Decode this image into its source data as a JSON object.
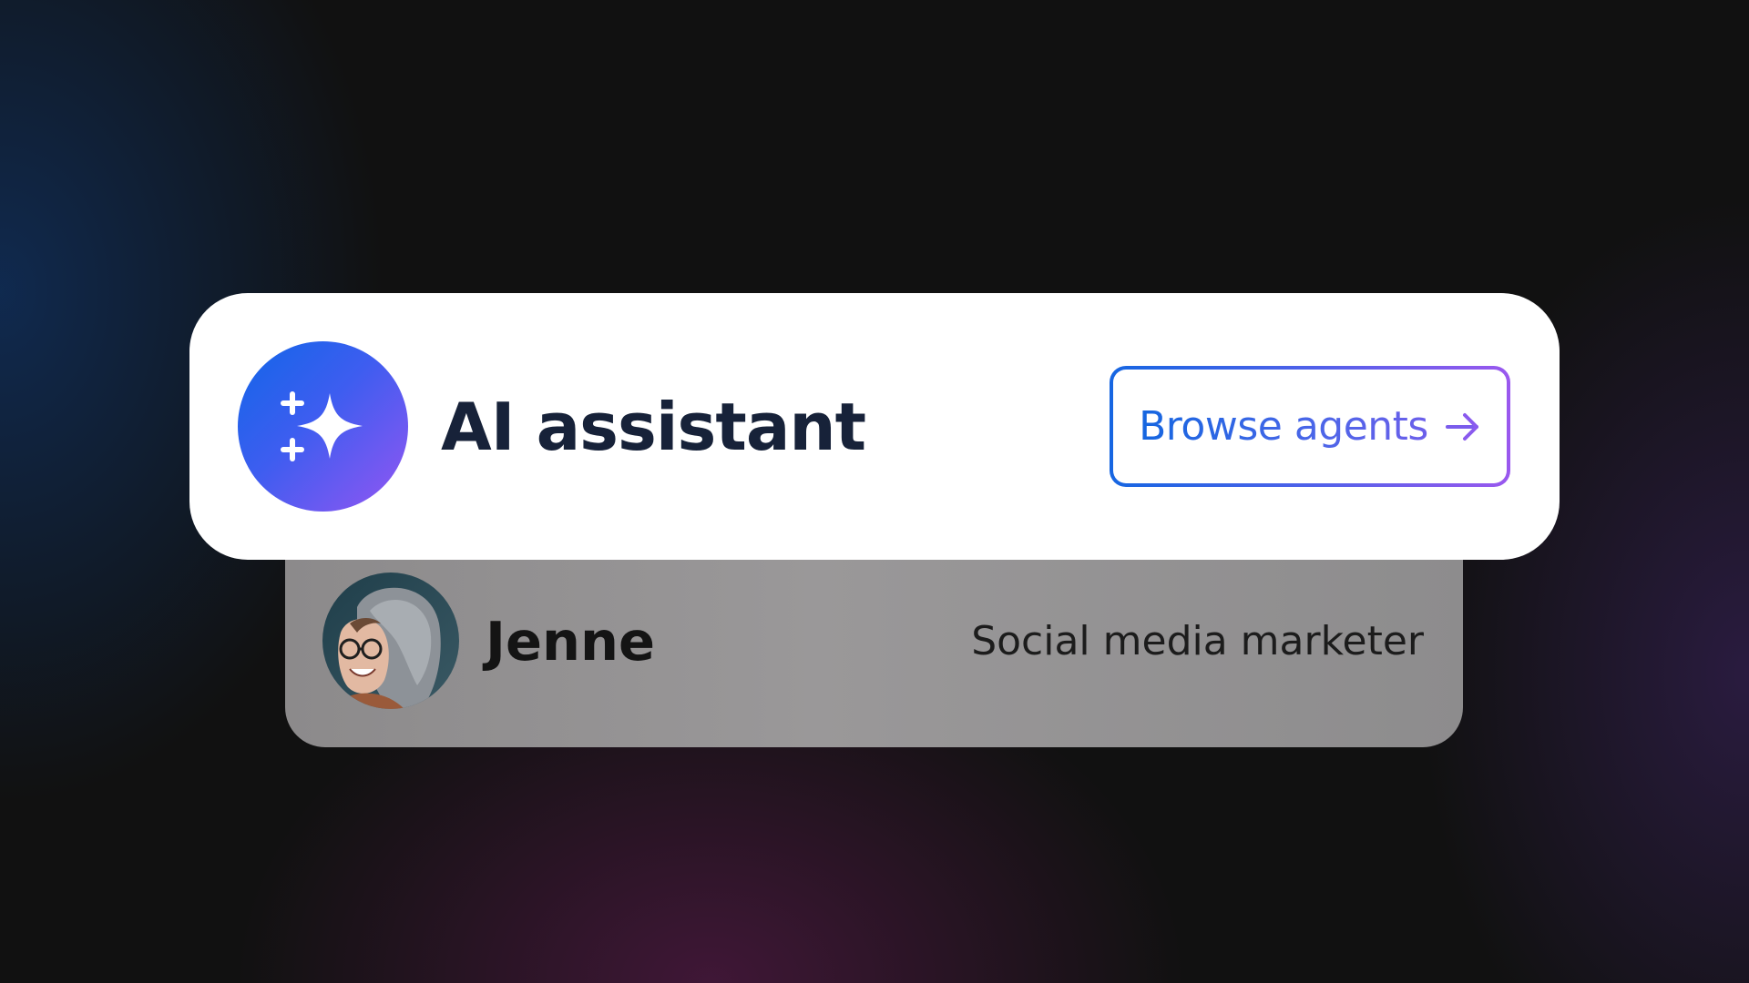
{
  "assistant": {
    "title": "AI assistant",
    "icon": "sparkle-icon",
    "browse_button_label": "Browse agents",
    "browse_button_icon": "arrow-right-icon"
  },
  "agent": {
    "name": "Jenne",
    "role": "Social media marketer",
    "avatar": "avatar-photo"
  },
  "colors": {
    "accent_blue": "#1166e8",
    "accent_purple": "#9456f2",
    "title_text": "#172239",
    "background": "#111111"
  }
}
